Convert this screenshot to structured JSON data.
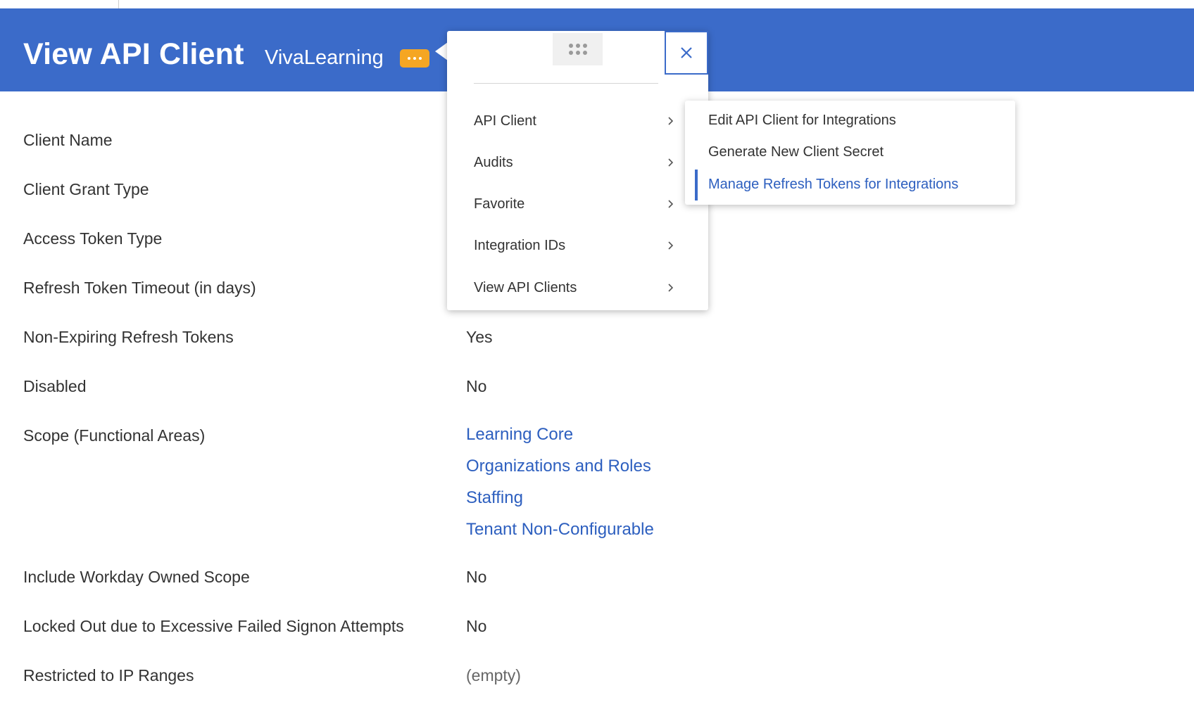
{
  "header": {
    "title": "View API Client",
    "subtitle": "VivaLearning"
  },
  "fields": [
    {
      "label": "Client Name",
      "value": ""
    },
    {
      "label": "Client Grant Type",
      "value": ""
    },
    {
      "label": "Access Token Type",
      "value": ""
    },
    {
      "label": "Refresh Token Timeout (in days)",
      "value": ""
    },
    {
      "label": "Non-Expiring Refresh Tokens",
      "value": "Yes"
    },
    {
      "label": "Disabled",
      "value": "No"
    },
    {
      "label": "Scope (Functional Areas)",
      "links": [
        "Learning Core",
        "Organizations and Roles",
        "Staffing",
        "Tenant Non-Configurable"
      ]
    },
    {
      "label": "Include Workday Owned Scope",
      "value": "No"
    },
    {
      "label": "Locked Out due to Excessive Failed Signon Attempts",
      "value": "No"
    },
    {
      "label": "Restricted to IP Ranges",
      "value": "(empty)"
    }
  ],
  "related_actions_menu": {
    "items": [
      {
        "label": "API Client"
      },
      {
        "label": "Audits"
      },
      {
        "label": "Favorite"
      },
      {
        "label": "Integration IDs"
      },
      {
        "label": "View API Clients"
      }
    ]
  },
  "submenu": {
    "items": [
      {
        "label": "Edit API Client for Integrations"
      },
      {
        "label": "Generate New Client Secret"
      },
      {
        "label": "Manage Refresh Tokens for Integrations"
      }
    ]
  },
  "colors": {
    "header_bg": "#3b6bc9",
    "link": "#2d5fbf",
    "related_button": "#f5a623"
  },
  "icons": {
    "related_actions": "ellipsis-icon",
    "drag_handle": "drag-dots-icon",
    "close": "close-icon",
    "chevron": "chevron-right-icon"
  }
}
